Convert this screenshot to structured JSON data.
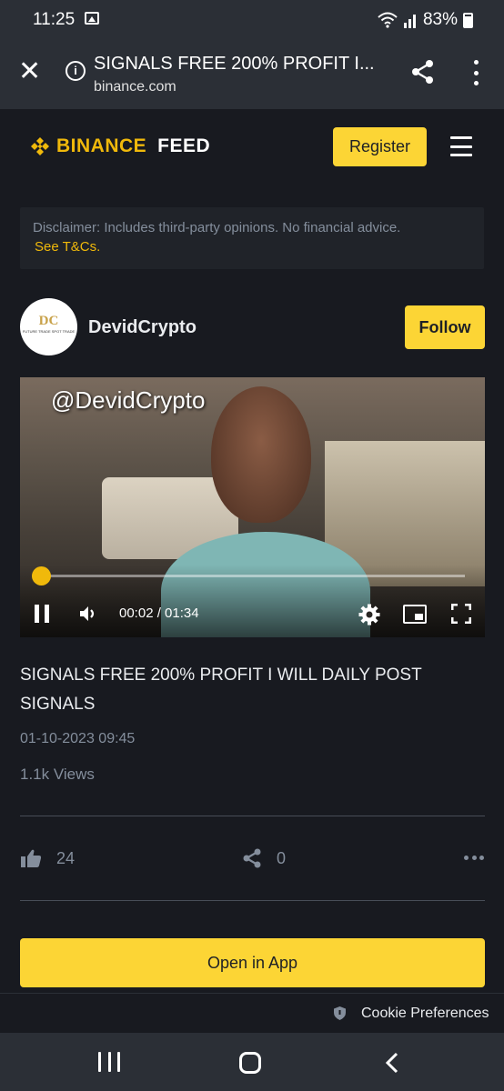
{
  "status_bar": {
    "time": "11:25",
    "battery": "83%",
    "icons": [
      "gallery-icon",
      "wifi-icon",
      "signal-icon",
      "battery-icon"
    ]
  },
  "browser": {
    "page_title": "SIGNALS FREE 200% PROFIT I...",
    "url": "binance.com"
  },
  "site_header": {
    "brand": "BINANCE",
    "section": "FEED",
    "register_label": "Register",
    "brand_color": "#f0b90b"
  },
  "disclaimer": {
    "text": "Disclaimer: Includes third-party opinions. No financial advice.",
    "link": "See T&Cs."
  },
  "post": {
    "author": {
      "name": "DevidCrypto",
      "avatar_mark": "DC",
      "avatar_sub": "FUTURE TRADE SPOT TRADE"
    },
    "follow_label": "Follow",
    "video": {
      "overlay_handle": "@DevidCrypto",
      "time": "00:02 / 01:34",
      "progress": 0.02
    },
    "title": "SIGNALS FREE 200% PROFIT I WILL DAILY POST SIGNALS",
    "date": "01-10-2023 09:45",
    "views": "1.1k Views",
    "likes": "24",
    "shares": "0"
  },
  "open_in_app_label": "Open in App",
  "cookie": {
    "label": "Cookie Preferences"
  },
  "accent_yellow": "#fcd535"
}
